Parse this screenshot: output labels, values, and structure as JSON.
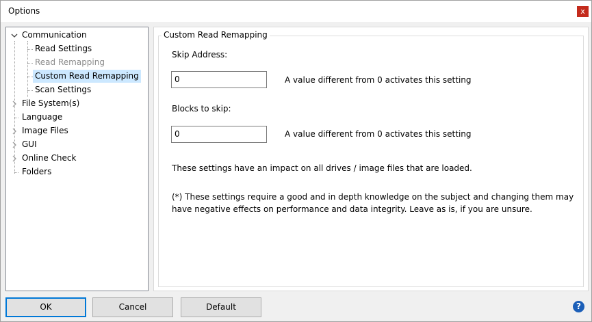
{
  "window": {
    "title": "Options",
    "close_label": "x"
  },
  "tree": {
    "items": [
      {
        "label": "Communication",
        "expanded": true
      },
      {
        "label": "Read Settings"
      },
      {
        "label": "Read Remapping",
        "disabled": true
      },
      {
        "label": "Custom Read Remapping",
        "selected": true
      },
      {
        "label": "Scan Settings"
      },
      {
        "label": "File System(s)",
        "collapsed": true
      },
      {
        "label": "Language"
      },
      {
        "label": "Image Files",
        "collapsed": true
      },
      {
        "label": "GUI",
        "collapsed": true
      },
      {
        "label": "Online Check",
        "collapsed": true
      },
      {
        "label": "Folders"
      }
    ]
  },
  "panel": {
    "group_title": "Custom Read Remapping",
    "skip_address_label": "Skip Address:",
    "skip_address_value": "0",
    "skip_address_hint": "A value different from 0 activates this setting",
    "blocks_label": "Blocks to skip:",
    "blocks_value": "0",
    "blocks_hint": "A value different from 0 activates this setting",
    "impact_note": "These settings have an impact on all drives / image files that are loaded.",
    "warning_line1": "(*) These settings require a good and in depth knowledge on the subject and changing them may",
    "warning_line2": "have negative effects on performance and data integrity.  Leave as is, if you are unsure."
  },
  "buttons": {
    "ok": "OK",
    "cancel": "Cancel",
    "default": "Default",
    "help_glyph": "?"
  },
  "colors": {
    "accent": "#0078d7",
    "selection": "#cce8ff",
    "close": "#c42b1c"
  }
}
